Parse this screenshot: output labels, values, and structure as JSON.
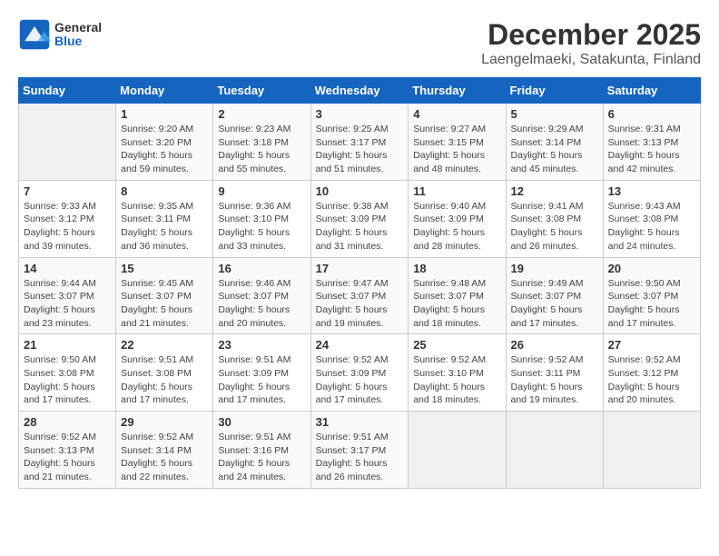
{
  "header": {
    "logo": {
      "general": "General",
      "blue": "Blue"
    },
    "title": "December 2025",
    "location": "Laengelmaeki, Satakunta, Finland"
  },
  "calendar": {
    "weekdays": [
      "Sunday",
      "Monday",
      "Tuesday",
      "Wednesday",
      "Thursday",
      "Friday",
      "Saturday"
    ],
    "weeks": [
      [
        {
          "day": "",
          "info": ""
        },
        {
          "day": "1",
          "info": "Sunrise: 9:20 AM\nSunset: 3:20 PM\nDaylight: 5 hours\nand 59 minutes."
        },
        {
          "day": "2",
          "info": "Sunrise: 9:23 AM\nSunset: 3:18 PM\nDaylight: 5 hours\nand 55 minutes."
        },
        {
          "day": "3",
          "info": "Sunrise: 9:25 AM\nSunset: 3:17 PM\nDaylight: 5 hours\nand 51 minutes."
        },
        {
          "day": "4",
          "info": "Sunrise: 9:27 AM\nSunset: 3:15 PM\nDaylight: 5 hours\nand 48 minutes."
        },
        {
          "day": "5",
          "info": "Sunrise: 9:29 AM\nSunset: 3:14 PM\nDaylight: 5 hours\nand 45 minutes."
        },
        {
          "day": "6",
          "info": "Sunrise: 9:31 AM\nSunset: 3:13 PM\nDaylight: 5 hours\nand 42 minutes."
        }
      ],
      [
        {
          "day": "7",
          "info": "Sunrise: 9:33 AM\nSunset: 3:12 PM\nDaylight: 5 hours\nand 39 minutes."
        },
        {
          "day": "8",
          "info": "Sunrise: 9:35 AM\nSunset: 3:11 PM\nDaylight: 5 hours\nand 36 minutes."
        },
        {
          "day": "9",
          "info": "Sunrise: 9:36 AM\nSunset: 3:10 PM\nDaylight: 5 hours\nand 33 minutes."
        },
        {
          "day": "10",
          "info": "Sunrise: 9:38 AM\nSunset: 3:09 PM\nDaylight: 5 hours\nand 31 minutes."
        },
        {
          "day": "11",
          "info": "Sunrise: 9:40 AM\nSunset: 3:09 PM\nDaylight: 5 hours\nand 28 minutes."
        },
        {
          "day": "12",
          "info": "Sunrise: 9:41 AM\nSunset: 3:08 PM\nDaylight: 5 hours\nand 26 minutes."
        },
        {
          "day": "13",
          "info": "Sunrise: 9:43 AM\nSunset: 3:08 PM\nDaylight: 5 hours\nand 24 minutes."
        }
      ],
      [
        {
          "day": "14",
          "info": "Sunrise: 9:44 AM\nSunset: 3:07 PM\nDaylight: 5 hours\nand 23 minutes."
        },
        {
          "day": "15",
          "info": "Sunrise: 9:45 AM\nSunset: 3:07 PM\nDaylight: 5 hours\nand 21 minutes."
        },
        {
          "day": "16",
          "info": "Sunrise: 9:46 AM\nSunset: 3:07 PM\nDaylight: 5 hours\nand 20 minutes."
        },
        {
          "day": "17",
          "info": "Sunrise: 9:47 AM\nSunset: 3:07 PM\nDaylight: 5 hours\nand 19 minutes."
        },
        {
          "day": "18",
          "info": "Sunrise: 9:48 AM\nSunset: 3:07 PM\nDaylight: 5 hours\nand 18 minutes."
        },
        {
          "day": "19",
          "info": "Sunrise: 9:49 AM\nSunset: 3:07 PM\nDaylight: 5 hours\nand 17 minutes."
        },
        {
          "day": "20",
          "info": "Sunrise: 9:50 AM\nSunset: 3:07 PM\nDaylight: 5 hours\nand 17 minutes."
        }
      ],
      [
        {
          "day": "21",
          "info": "Sunrise: 9:50 AM\nSunset: 3:08 PM\nDaylight: 5 hours\nand 17 minutes."
        },
        {
          "day": "22",
          "info": "Sunrise: 9:51 AM\nSunset: 3:08 PM\nDaylight: 5 hours\nand 17 minutes."
        },
        {
          "day": "23",
          "info": "Sunrise: 9:51 AM\nSunset: 3:09 PM\nDaylight: 5 hours\nand 17 minutes."
        },
        {
          "day": "24",
          "info": "Sunrise: 9:52 AM\nSunset: 3:09 PM\nDaylight: 5 hours\nand 17 minutes."
        },
        {
          "day": "25",
          "info": "Sunrise: 9:52 AM\nSunset: 3:10 PM\nDaylight: 5 hours\nand 18 minutes."
        },
        {
          "day": "26",
          "info": "Sunrise: 9:52 AM\nSunset: 3:11 PM\nDaylight: 5 hours\nand 19 minutes."
        },
        {
          "day": "27",
          "info": "Sunrise: 9:52 AM\nSunset: 3:12 PM\nDaylight: 5 hours\nand 20 minutes."
        }
      ],
      [
        {
          "day": "28",
          "info": "Sunrise: 9:52 AM\nSunset: 3:13 PM\nDaylight: 5 hours\nand 21 minutes."
        },
        {
          "day": "29",
          "info": "Sunrise: 9:52 AM\nSunset: 3:14 PM\nDaylight: 5 hours\nand 22 minutes."
        },
        {
          "day": "30",
          "info": "Sunrise: 9:51 AM\nSunset: 3:16 PM\nDaylight: 5 hours\nand 24 minutes."
        },
        {
          "day": "31",
          "info": "Sunrise: 9:51 AM\nSunset: 3:17 PM\nDaylight: 5 hours\nand 26 minutes."
        },
        {
          "day": "",
          "info": ""
        },
        {
          "day": "",
          "info": ""
        },
        {
          "day": "",
          "info": ""
        }
      ]
    ]
  }
}
